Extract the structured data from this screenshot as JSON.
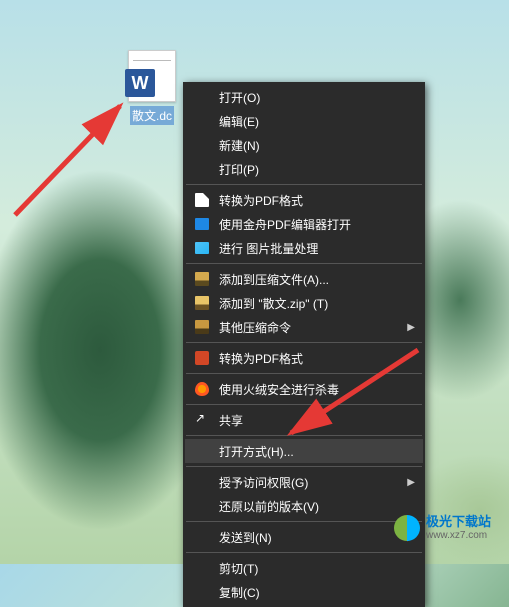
{
  "file": {
    "name": "散文.dc",
    "badge": "W"
  },
  "menu": {
    "items": [
      {
        "label": "打开(O)",
        "icon": null
      },
      {
        "label": "编辑(E)",
        "icon": null
      },
      {
        "label": "新建(N)",
        "icon": null
      },
      {
        "label": "打印(P)",
        "icon": null
      },
      {
        "sep": true
      },
      {
        "label": "转换为PDF格式",
        "icon": "pdf"
      },
      {
        "label": "使用金舟PDF编辑器打开",
        "icon": "pdfblue"
      },
      {
        "label": "进行 图片批量处理",
        "icon": "img"
      },
      {
        "sep": true
      },
      {
        "label": "添加到压缩文件(A)...",
        "icon": "zip1"
      },
      {
        "label": "添加到 \"散文.zip\" (T)",
        "icon": "zip2"
      },
      {
        "label": "其他压缩命令",
        "icon": "zip3",
        "submenu": true
      },
      {
        "sep": true
      },
      {
        "label": "转换为PDF格式",
        "icon": "ppt"
      },
      {
        "sep": true
      },
      {
        "label": "使用火绒安全进行杀毒",
        "icon": "shield"
      },
      {
        "sep": true
      },
      {
        "label": "共享",
        "icon": "share"
      },
      {
        "sep": true
      },
      {
        "label": "打开方式(H)...",
        "icon": null,
        "highlighted": true
      },
      {
        "sep": true
      },
      {
        "label": "授予访问权限(G)",
        "icon": null,
        "submenu": true
      },
      {
        "label": "还原以前的版本(V)",
        "icon": null
      },
      {
        "sep": true
      },
      {
        "label": "发送到(N)",
        "icon": null,
        "submenu": true
      },
      {
        "sep": true
      },
      {
        "label": "剪切(T)",
        "icon": null
      },
      {
        "label": "复制(C)",
        "icon": null
      }
    ]
  },
  "watermark": {
    "title": "极光下载站",
    "url": "www.xz7.com"
  }
}
